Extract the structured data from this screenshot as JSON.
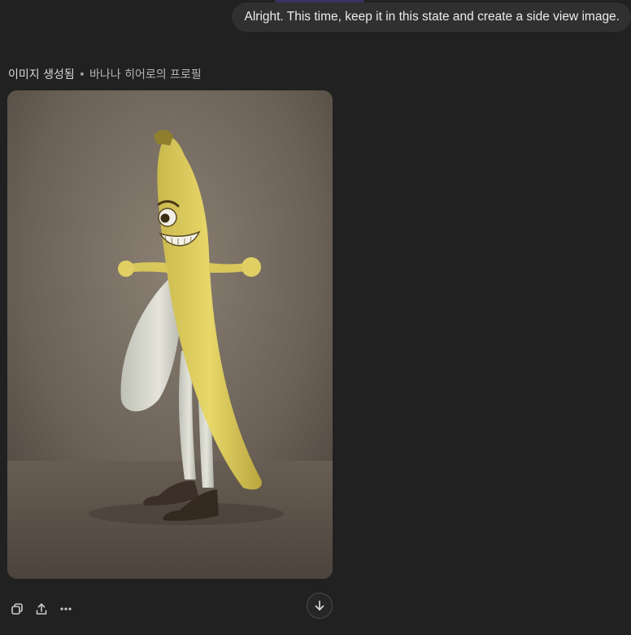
{
  "user_message": {
    "text": "Alright. This time, keep it in this state and create a side view image."
  },
  "generated_image": {
    "status": "이미지 생성됨",
    "separator": "•",
    "title": "바나나 히어로의 프로필"
  },
  "actions": {
    "icons": [
      "copy-icon",
      "share-icon",
      "more-icon",
      "download-icon"
    ]
  },
  "colors": {
    "background": "#212121",
    "bubble": "#303030",
    "text": "#ececec"
  }
}
